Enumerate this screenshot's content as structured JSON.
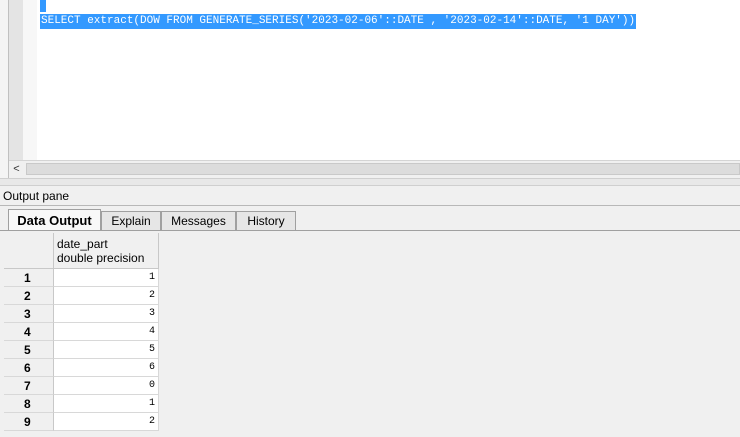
{
  "editor": {
    "sql": "SELECT extract(DOW FROM GENERATE_SERIES('2023-02-06'::DATE , '2023-02-14'::DATE, '1 DAY'))"
  },
  "scrollbar": {
    "left_arrow": "<"
  },
  "output_pane": {
    "title": "Output pane",
    "tabs": [
      "Data Output",
      "Explain",
      "Messages",
      "History"
    ],
    "active_tab": "Data Output"
  },
  "grid": {
    "column": {
      "name": "date_part",
      "type": "double precision"
    },
    "rows": [
      {
        "num": "1",
        "value": "1"
      },
      {
        "num": "2",
        "value": "2"
      },
      {
        "num": "3",
        "value": "3"
      },
      {
        "num": "4",
        "value": "4"
      },
      {
        "num": "5",
        "value": "5"
      },
      {
        "num": "6",
        "value": "6"
      },
      {
        "num": "7",
        "value": "0"
      },
      {
        "num": "8",
        "value": "1"
      },
      {
        "num": "9",
        "value": "2"
      }
    ]
  },
  "colors": {
    "selection": "#3399ff",
    "background": "#f0f0f0"
  }
}
